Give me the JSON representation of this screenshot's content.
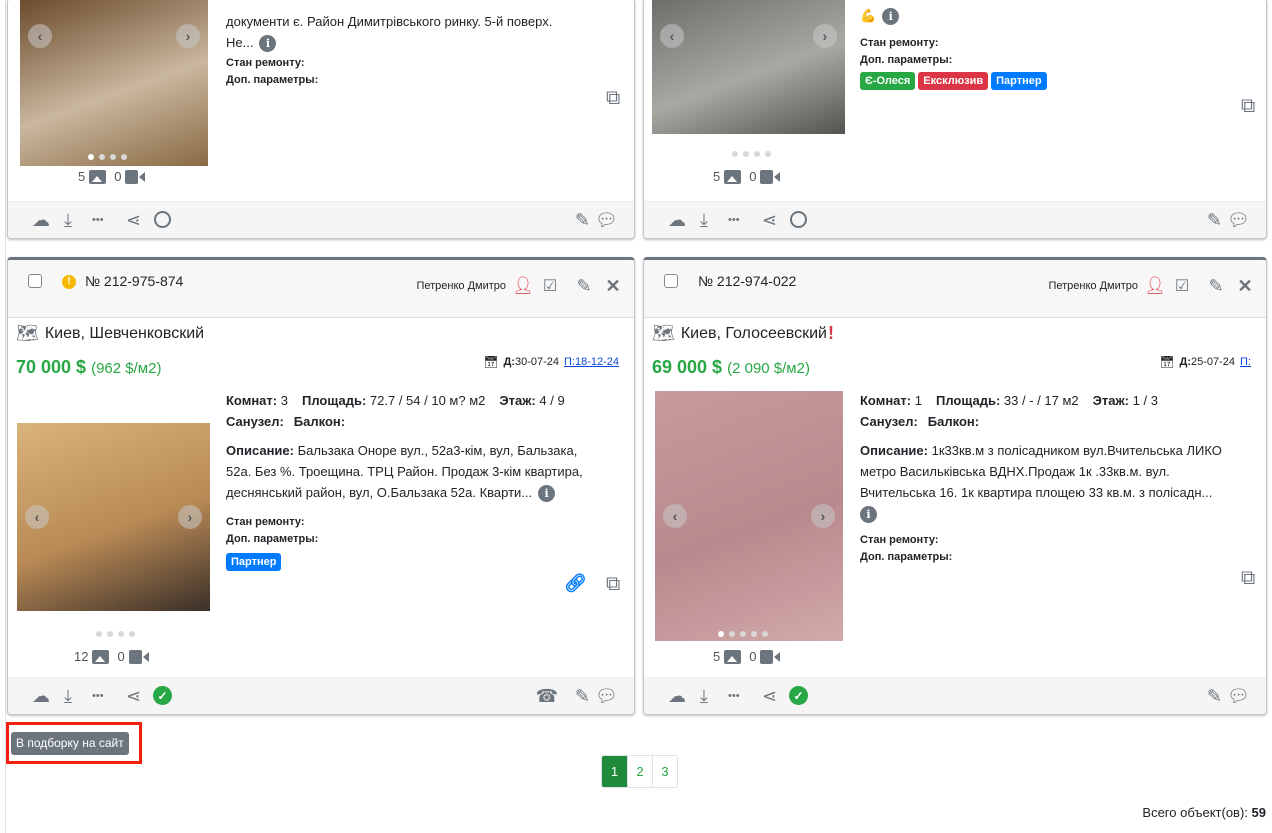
{
  "cards": [
    {
      "desc_tail": [
        "документи є. Район Димитрівського ринку. 5-й поверх.",
        "Не..."
      ],
      "repair_label": "Стан ремонту:",
      "params_label": "Доп. параметры:",
      "badges": [],
      "photo_count": "5",
      "video_count": "0",
      "status": "pending",
      "photo_colors": [
        "#6b4a2b",
        "#c9b79e",
        "#8a6a44"
      ]
    },
    {
      "desc_tail": [
        "💪"
      ],
      "repair_label": "Стан ремонту:",
      "params_label": "Доп. параметры:",
      "badges": [
        {
          "label": "Є-Олеся",
          "color": "#28a745"
        },
        {
          "label": "Ексклюзив",
          "color": "#dc3545"
        },
        {
          "label": "Партнер",
          "color": "#007bff"
        }
      ],
      "photo_count": "5",
      "video_count": "0",
      "status": "pending",
      "photo_colors": [
        "#6d6d6a",
        "#a9a8a3",
        "#55534f"
      ]
    },
    {
      "number": "№ 212-975-874",
      "warning": true,
      "agent": "Петренко Дмитро",
      "location": "Киев, Шевченковский",
      "price": "70 000 $",
      "price_m2": "(962 $/м2)",
      "date_label": "Д:",
      "date": "30-07-24",
      "update_link": "П:18-12-24",
      "rooms_label": "Комнат:",
      "rooms": "3",
      "area_label": "Площадь:",
      "area": "72.7 / 54 / 10 м? м2",
      "floor_label": "Этаж:",
      "floor": "4 / 9",
      "bath_label": "Санузел:",
      "balcony_label": "Балкон:",
      "desc_label": "Описание:",
      "desc": [
        "Бальзака Оноре вул., 52а3-кім, вул, Бальзака,",
        "52а. Без %. Троещина. ТРЦ Район. Продаж 3-кім квартира,",
        "деснянський район, вул, О.Бальзака 52а. Кварти..."
      ],
      "repair_label": "Стан ремонту:",
      "params_label": "Доп. параметры:",
      "badges": [
        {
          "label": "Партнер",
          "color": "#007bff"
        }
      ],
      "photo_count": "12",
      "video_count": "0",
      "status": "done",
      "photo_colors": [
        "#d9b47a",
        "#b98a55",
        "#3a2f28"
      ]
    },
    {
      "number": "№ 212-974-022",
      "warning": false,
      "agent": "Петренко Дмитро",
      "location": "Киев, Голосеевский",
      "alert": "!",
      "price": "69 000 $",
      "price_m2": "(2 090 $/м2)",
      "date_label": "Д:",
      "date": "25-07-24",
      "update_link": "П:",
      "rooms_label": "Комнат:",
      "rooms": "1",
      "area_label": "Площадь:",
      "area": "33 / - / 17 м2",
      "floor_label": "Этаж:",
      "floor": "1 / 3",
      "bath_label": "Санузел:",
      "balcony_label": "Балкон:",
      "desc_label": "Описание:",
      "desc": [
        "1к33кв.м з полісадником вул.Вчительська ЛИКО",
        "метро Васильківська ВДНХ.Продаж 1к .33кв.м. вул.",
        "Вчительська 16. 1к квартира площею 33 кв.м. з полісадн..."
      ],
      "repair_label": "Стан ремонту:",
      "params_label": "Доп. параметры:",
      "badges": [],
      "photo_count": "5",
      "video_count": "0",
      "status": "done",
      "photo_colors": [
        "#c79a9c",
        "#b88a8d",
        "#d3a9aa"
      ]
    }
  ],
  "selection_button": "В подборку на сайт",
  "pagination": [
    "1",
    "2",
    "3"
  ],
  "total_label": "Всего объект(ов):",
  "total_count": "59",
  "colors": {
    "price": "#28a745",
    "active_page": "#1e8a3a",
    "highlight": "#f4200f"
  }
}
